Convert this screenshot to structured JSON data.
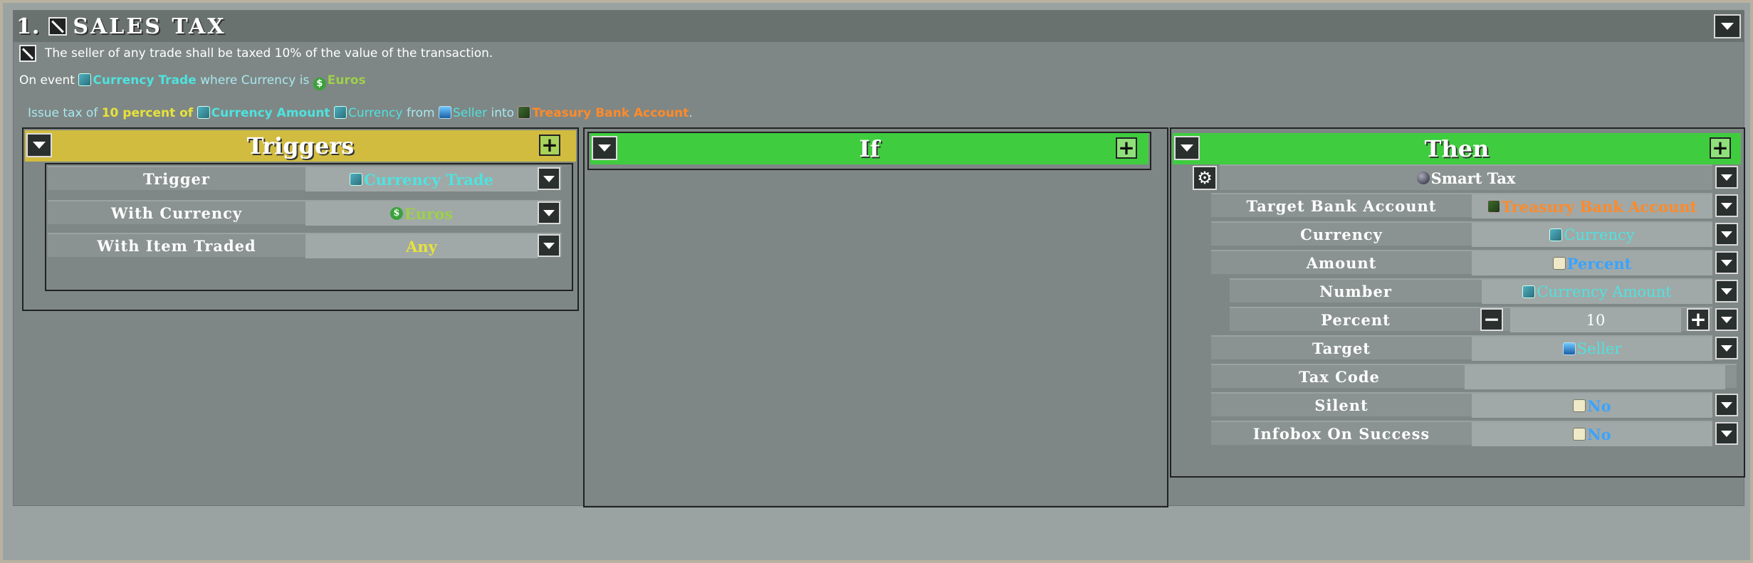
{
  "rule": {
    "number": "1.",
    "title": "Sales Tax",
    "description": "The seller of any trade shall be taxed 10% of the value of the transaction.",
    "on_event": {
      "prefix": "On event",
      "event": "Currency Trade",
      "where": "where Currency is",
      "currency": "Euros"
    },
    "summary": {
      "issue": "Issue tax of",
      "amount_text": "10 percent of",
      "amount_source": "Currency Amount",
      "currency": "Currency",
      "from": "from",
      "target": "Seller",
      "into": "into",
      "account": "Treasury Bank Account",
      "end": "."
    }
  },
  "triggers": {
    "header": "Triggers",
    "rows": [
      {
        "label": "Trigger",
        "value": "Currency Trade",
        "icon": "currency-icon"
      },
      {
        "label": "With Currency",
        "value": "Euros",
        "icon": "dollar-coin-icon"
      },
      {
        "label": "With Item Traded",
        "value": "Any",
        "icon": ""
      }
    ]
  },
  "if_panel": {
    "header": "If"
  },
  "then": {
    "header": "Then",
    "action": "Smart Tax",
    "rows": [
      {
        "label": "Target Bank Account",
        "value": "Treasury Bank Account"
      },
      {
        "label": "Currency",
        "value": "Currency"
      },
      {
        "label": "Amount",
        "value": "Percent"
      },
      {
        "label": "Number",
        "value": "Currency Amount"
      },
      {
        "label": "Percent",
        "value": "10"
      },
      {
        "label": "Target",
        "value": "Seller"
      },
      {
        "label": "Tax Code",
        "value": ""
      },
      {
        "label": "Silent",
        "value": "No"
      },
      {
        "label": "Infobox On Success",
        "value": "No"
      }
    ]
  },
  "colors": {
    "triggers_header": "#d1bc3f",
    "if_header": "#3fcc3f",
    "then_header": "#3fcc3f",
    "cyan": "#4fe2df",
    "orange": "#ff8a2a",
    "yellow": "#e8e23a",
    "blue": "#3aa3ff",
    "green_value": "#9ed04a"
  }
}
